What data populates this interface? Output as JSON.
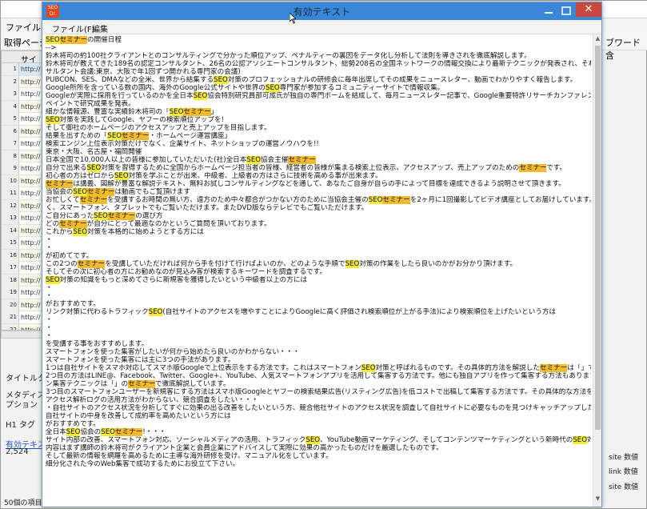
{
  "bg": {
    "menu_file": "ファイル(F)",
    "tab_left": "取得ページ",
    "tab_right": "ブワード含",
    "col_header": "サイトU",
    "rows": [
      {
        "n": "1",
        "url": "http://"
      },
      {
        "n": "2",
        "url": "http://"
      },
      {
        "n": "3",
        "url": "http://"
      },
      {
        "n": "4",
        "url": "http://"
      },
      {
        "n": "5",
        "url": "http://"
      },
      {
        "n": "6",
        "url": "http://"
      },
      {
        "n": "7",
        "url": "http://"
      },
      {
        "n": "8",
        "url": "http://"
      },
      {
        "n": "9",
        "url": "http://"
      },
      {
        "n": "10",
        "url": "http://"
      },
      {
        "n": "11",
        "url": "http://"
      },
      {
        "n": "12",
        "url": "http://"
      },
      {
        "n": "13",
        "url": "http://"
      },
      {
        "n": "14",
        "url": "http://"
      },
      {
        "n": "15",
        "url": "http://"
      },
      {
        "n": "16",
        "url": "http://"
      },
      {
        "n": "17",
        "url": "http://"
      },
      {
        "n": "18",
        "url": "http://"
      },
      {
        "n": "19",
        "url": "http://"
      },
      {
        "n": "20",
        "url": "http://"
      },
      {
        "n": "21",
        "url": "http://"
      },
      {
        "n": "22",
        "url": "http://"
      },
      {
        "n": "23",
        "url": "http://"
      },
      {
        "n": "24",
        "url": "http://"
      },
      {
        "n": "25",
        "url": "http://"
      }
    ],
    "label_title": "タイトルタ",
    "label_meta1": "メタディスク",
    "label_meta2": "プション",
    "label_h1": "H1 タグ",
    "link_text": "有効テキス",
    "count": "2,524",
    "footer": "50個の項目",
    "right_labels": [
      "site 数値",
      "link 数値",
      "site 数値"
    ]
  },
  "window": {
    "title": "有効テキスト",
    "menu": [
      "ファイル(F)",
      "編集"
    ],
    "close_glyph": "✕",
    "min_glyph": "—",
    "max_glyph": "□"
  },
  "lines": [
    [
      {
        "t": "SEO",
        "h": "y"
      },
      {
        "t": "セミナー",
        "h": "o"
      },
      {
        "t": "の開催日程"
      }
    ],
    [
      {
        "t": "-->"
      }
    ],
    [
      {
        "t": "鈴木将司の約100社クライアントとのコンサルティングで分かった順位アップ、ペナルティーの裏因をデータ化し分析して法則を導きされを徹底解説します。"
      }
    ],
    [
      {
        "t": "鈴木将司が教えてきた189名の認定コンサルタント、26名の公認アソシエートコンサルタント、総勢208名の全国ネットワークの情報交換により最新テクニックが発表され、それを会員の皆様に報告します。(認定コン"
      }
    ],
    [
      {
        "t": "サルタント会議:東京、大阪で年1回ずつ開かれる専門家の会議)"
      }
    ],
    [
      {
        "t": "PUBCON、SES、DMAなどの全米、世界から結集する"
      },
      {
        "t": "SEO",
        "h": "y"
      },
      {
        "t": "対策のプロフェッショナルの研修会に毎年出席してその成果をニュースレター、動画でわかりやすく報告します。"
      }
    ],
    [
      {
        "t": "Google所所を含っている数の国内、海外のGoogle公式サイトや世界の"
      },
      {
        "t": "SEO",
        "h": "y"
      },
      {
        "t": "専門家が参加するコミュニティーサイトで情報収集。"
      }
    ],
    [
      {
        "t": "Googleが実際に採用を行っているのかを全日本"
      },
      {
        "t": "SEO",
        "h": "y"
      },
      {
        "t": "協会特別研究員部可成氏が独自の専門ボームを結成して、毎月ニュースレター記事で、Google重要特許リサーチカンファレンスという会員様縁料を行い"
      }
    ],
    [
      {
        "t": "ペイントで研究成果を発表。"
      }
    ],
    [
      {
        "t": "細かな情報源、豊富な実績鈴木将司の「"
      },
      {
        "t": "SEO",
        "h": "y"
      },
      {
        "t": "セミナー",
        "h": "o"
      },
      {
        "t": "」"
      }
    ],
    [
      {
        "t": "SEO",
        "h": "y"
      },
      {
        "t": "対策を実践してGoogle、ヤフーの検索順位アップを!"
      }
    ],
    [
      {
        "t": "そして御社のホームページのアクセスアップと売上アップを目指します。"
      }
    ],
    [
      {
        "t": "結果を出すための「"
      },
      {
        "t": "SEO",
        "h": "y"
      },
      {
        "t": "セミナー",
        "h": "o"
      },
      {
        "t": "・ホームページ運営講座」"
      }
    ],
    [
      {
        "t": "検索エンジン上位表示対策だけでなく、企業サイト、ネットショップの運営ノウハウを!!"
      }
    ],
    [
      {
        "t": "東京・大阪、名古屋・福岡開催"
      }
    ],
    [
      {
        "t": "日本全国で10,000人以上の皆様に参加していただいた(社)全日本"
      },
      {
        "t": "SEO",
        "h": "y"
      },
      {
        "t": "協会主催"
      },
      {
        "t": "セミナー",
        "h": "o"
      }
    ],
    [
      {
        "t": "自分で出来る"
      },
      {
        "t": "SEO",
        "h": "y"
      },
      {
        "t": "対策を習得するために全国からホームページ担当者の皆様、経営者の皆様が集まる検索上位表示、アクセスアップ、売上アップのための"
      },
      {
        "t": "セミナー",
        "h": "o"
      },
      {
        "t": "です。"
      }
    ],
    [
      {
        "t": "初心者の方はゼロから"
      },
      {
        "t": "SEO",
        "h": "y"
      },
      {
        "t": "対策を学ぶことが出来、中級者、上級者の方はさらに技術を高める事が出来ます。"
      }
    ],
    [
      {
        "t": "セミナー",
        "h": "o"
      },
      {
        "t": "は講義、図解が豊富な解説テキスト、無料お試しコンサルティングなどを通して、あなたご自身が自らの手によって目標を達成できるよう説明させて頂きます。"
      }
    ],
    [
      {
        "t": "当協会の"
      },
      {
        "t": "SEO",
        "h": "y"
      },
      {
        "t": "セミナー",
        "h": "o"
      },
      {
        "t": "は動画でもご覧頂けます"
      }
    ],
    [
      {
        "t": "お忙しくて"
      },
      {
        "t": "セミナー",
        "h": "o"
      },
      {
        "t": "を受講するお時間の無い方、遠方のため中々都合がつかない方のために当協会主催の"
      },
      {
        "t": "SEO",
        "h": "y"
      },
      {
        "t": "セミナー",
        "h": "o"
      },
      {
        "t": "を2ヶ月に1回撮影してビデオ講座としてお届けしています。オンライン版はパソコンだけではな"
      }
    ],
    [
      {
        "t": "く、スマートフォン、タブレットでもご覧いただけます。またDVD版ならテレビでもご覧いただけます。"
      }
    ],
    [
      {
        "t": "ご自分にあった"
      },
      {
        "t": "SEO",
        "h": "y"
      },
      {
        "t": "セミナー",
        "h": "o"
      },
      {
        "t": "の選び方"
      }
    ],
    [
      {
        "t": "どの"
      },
      {
        "t": "セミナー",
        "h": "o"
      },
      {
        "t": "が自分にとって最適なのかというご質問を頂いております。"
      }
    ],
    [
      {
        "t": "これから"
      },
      {
        "t": "SEO",
        "h": "y"
      },
      {
        "t": "対策を本格的に始めようとする方には"
      }
    ],
    [
      {
        "t": "・"
      }
    ],
    [
      {
        "t": "・"
      }
    ],
    [
      {
        "t": "が初めてです。"
      }
    ],
    [
      {
        "t": "この2つの"
      },
      {
        "t": "セミナー",
        "h": "o"
      },
      {
        "t": "を受講していただければ何から手を付けて行けばよいのか、どのような手順で"
      },
      {
        "t": "SEO",
        "h": "y"
      },
      {
        "t": "対策の作業をしたら良いのかがお分かり頂けます。"
      }
    ],
    [
      {
        "t": "そしてその次に初心者の方にお勧めなのが見込み客が検索するキーワードを調査するです。"
      }
    ],
    [
      {
        "t": "SEO",
        "h": "y"
      },
      {
        "t": "対策の知識をもっと深めてさらに新規客を獲得したいという中級者以上の方には"
      }
    ],
    [
      {
        "t": "・"
      }
    ],
    [
      {
        "t": "・"
      }
    ],
    [
      {
        "t": "がおすすめです。"
      }
    ],
    [
      {
        "t": "リンク対策に代わるトラフィック"
      },
      {
        "t": "SEO",
        "h": "y"
      },
      {
        "t": "(自社サイトのアクセスを増やすことによりGoogleに高く評価され検索順位が上がる手法)により検索順位を上げたいという方は"
      }
    ],
    [
      {
        "t": "・"
      }
    ],
    [
      {
        "t": "・"
      }
    ],
    [
      {
        "t": "・"
      }
    ],
    [
      {
        "t": "を受講する事をおすすめします。"
      }
    ],
    [
      {
        "t": "スマートフォンを使った集客がしたいが何から始めたら良いのかわからない・・・"
      }
    ],
    [
      {
        "t": "スマートフォンを使った集客には主に3つの手法があります。"
      }
    ],
    [
      {
        "t": "1つは自社サイトをスマホ対応してスマホ版Googleで上位表示をする方法です。これはスマートフォン"
      },
      {
        "t": "SEO",
        "h": "y"
      },
      {
        "t": "対策と呼ばれるものです。その具体的方法を解説した"
      },
      {
        "t": "セミナー",
        "h": "o"
      },
      {
        "t": "は「」です。"
      }
    ],
    [
      {
        "t": "2つ目の方法はLINE@、Facebook、Twitter、Google+、YouTube、人気スマートフォンアプリを活用して集客する方法です。他にも独自アプリを作って集客する方法もあります。そうした方法を活用したスマートフォ"
      }
    ],
    [
      {
        "t": "ン集客テクニックは「」の"
      },
      {
        "t": "セミナー",
        "h": "o"
      },
      {
        "t": "で徹底解説しています。"
      }
    ],
    [
      {
        "t": "3つ目のスマートフォンユーザーを新規客にする方法はスマホ版Googleとヤフーの検索結果広告(リスティング広告)を低コストで出稿して集客する方法です。その具体的な方法を解説した"
      },
      {
        "t": "セミナー",
        "h": "o"
      },
      {
        "t": "は「」です。"
      }
    ],
    [
      {
        "t": "アクセス解析ログの活用方法がわからない、競合調査をしたい・・・"
      }
    ],
    [
      {
        "t": "・自社サイトのアクセス状況を分析してすぐに効果の出る改善をしたいという方、競合他社サイトのアクセス状況を調査して自社サイトに必要なものを見つけキャッチアップしたいという方は「」がおすすめです。"
      }
    ],
    [
      {
        "t": "自社サイトの中身を改善して成約率を高めたいという方には"
      }
    ],
    [
      {
        "t": "がおすすめです。"
      }
    ],
    [
      {
        "t": "全日本"
      },
      {
        "t": "SEO",
        "h": "y"
      },
      {
        "t": "協会の"
      },
      {
        "t": "SEO",
        "h": "y"
      },
      {
        "t": "セミナー",
        "h": "o"
      },
      {
        "t": "!・・・"
      }
    ],
    [
      {
        "t": "サイト内部の改善、スマートフォン対応、ソーシャルメディアの活用、トラフィック"
      },
      {
        "t": "SEO",
        "h": "y"
      },
      {
        "t": "、YouTube動画マーケティング、そしてコンテンツマーケティングという新時代の"
      },
      {
        "t": "SEO",
        "h": "y"
      },
      {
        "t": "対策技術を総合的に提供しています。"
      }
    ],
    [
      {
        "t": "内容はまず講師の鈴木将司がクライアント企業と会員企業にアドバイスして実際に効果の高かったものだけを厳選したものです。"
      }
    ],
    [
      {
        "t": "そして最新の情報を網羅を高めるために主導な海外研修を受け、マニュアル化をしています。"
      }
    ],
    [
      {
        "t": "細分化された今のWeb集客で成功するためにお役立て下さい。"
      }
    ]
  ]
}
